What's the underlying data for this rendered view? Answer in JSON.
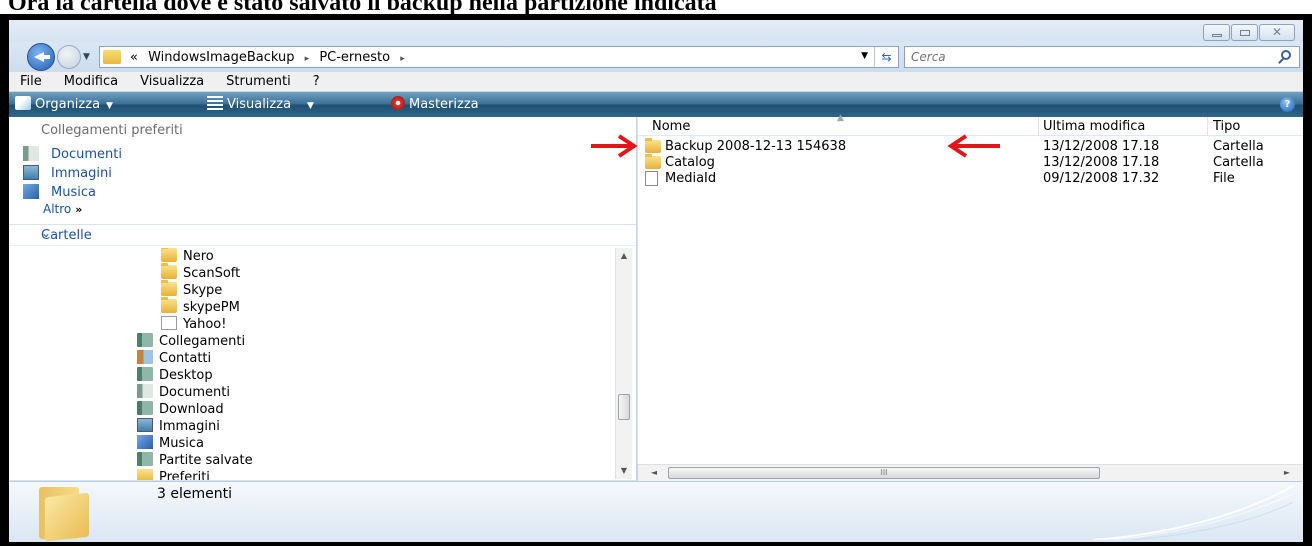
{
  "caption": "Ora la cartella dove è stato salvato il backup nella partizione indicata",
  "window": {
    "controls": {
      "minimize": "minimize",
      "maximize": "maximize",
      "close": "close"
    }
  },
  "address": {
    "prefix": "«",
    "crumbs": [
      "WindowsImageBackup",
      "PC-ernesto"
    ],
    "separator": "▸",
    "search_placeholder": "Cerca"
  },
  "menubar": [
    "File",
    "Modifica",
    "Visualizza",
    "Strumenti",
    "?"
  ],
  "commands": {
    "organize": "Organizza",
    "views": "Visualizza",
    "burn": "Masterizza"
  },
  "favorites": {
    "header": "Collegamenti preferiti",
    "items": [
      "Documenti",
      "Immagini",
      "Musica"
    ],
    "more": "Altro",
    "more_glyph": "»"
  },
  "folders": {
    "header": "Cartelle",
    "tree": [
      {
        "label": "Nero",
        "icon": "folder-icon"
      },
      {
        "label": "ScanSoft",
        "icon": "folder-icon"
      },
      {
        "label": "Skype",
        "icon": "folder-icon"
      },
      {
        "label": "skypePM",
        "icon": "folder-icon"
      },
      {
        "label": "Yahoo!",
        "icon": "yahoo-folder-icon"
      },
      {
        "label": "Collegamenti",
        "icon": "library-icon"
      },
      {
        "label": "Contatti",
        "icon": "contacts-icon"
      },
      {
        "label": "Desktop",
        "icon": "library-icon"
      },
      {
        "label": "Documenti",
        "icon": "documents-icon"
      },
      {
        "label": "Download",
        "icon": "library-icon"
      },
      {
        "label": "Immagini",
        "icon": "pictures-icon"
      },
      {
        "label": "Musica",
        "icon": "music-icon"
      },
      {
        "label": "Partite salvate",
        "icon": "library-icon"
      },
      {
        "label": "Preferiti",
        "icon": "favorites-icon"
      }
    ]
  },
  "columns": [
    "Nome",
    "Ultima modifica",
    "Tipo"
  ],
  "files": [
    {
      "name": "Backup 2008-12-13 154638",
      "modified": "13/12/2008 17.18",
      "type": "Cartella",
      "icon": "folder-icon"
    },
    {
      "name": "Catalog",
      "modified": "13/12/2008 17.18",
      "type": "Cartella",
      "icon": "folder-icon"
    },
    {
      "name": "MediaId",
      "modified": "09/12/2008 17.32",
      "type": "File",
      "icon": "file-icon"
    }
  ],
  "status": {
    "count": "3 elementi"
  },
  "hscroll_grip": "III",
  "colors": {
    "annotation_arrow": "#e2151b",
    "link": "#1a52a8",
    "command_bar": "#2f6688"
  }
}
